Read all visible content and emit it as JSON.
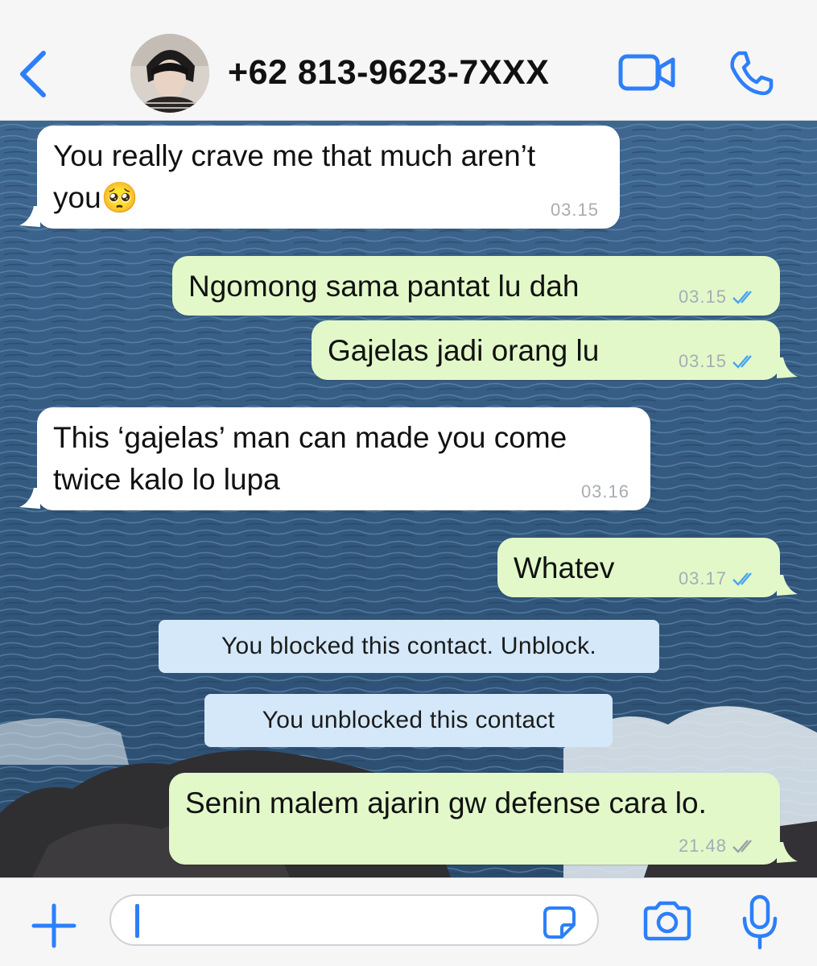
{
  "header": {
    "contact_name": "+62 813-9623-7XXX",
    "icons": {
      "back": "chevron-left-icon",
      "video": "video-camera-icon",
      "call": "phone-icon"
    },
    "accent_color": "#2d7ff9"
  },
  "messages": [
    {
      "direction": "incoming",
      "lines": [
        "You really crave me that much aren’t",
        "you🥺"
      ],
      "time": "03.15"
    },
    {
      "direction": "outgoing",
      "lines": [
        "Ngomong sama pantat lu dah"
      ],
      "time": "03.15",
      "status": "read"
    },
    {
      "direction": "outgoing",
      "lines": [
        "Gajelas jadi orang lu"
      ],
      "time": "03.15",
      "status": "read"
    },
    {
      "direction": "incoming",
      "lines": [
        "This ‘gajelas’ man can made you come",
        "twice kalo lo lupa"
      ],
      "time": "03.16"
    },
    {
      "direction": "outgoing",
      "lines": [
        "Whatev"
      ],
      "time": "03.17",
      "status": "read"
    },
    {
      "direction": "outgoing",
      "lines": [
        "Senin malem ajarin gw defense cara lo."
      ],
      "time": "21.48",
      "status": "delivered"
    }
  ],
  "system_messages": [
    {
      "text": "You blocked this contact. Unblock."
    },
    {
      "text": "You unblocked this contact"
    }
  ],
  "input_bar": {
    "value": "",
    "icons": {
      "plus": "plus-icon",
      "sticker": "sticker-icon",
      "camera": "camera-icon",
      "mic": "microphone-icon"
    }
  },
  "colors": {
    "incoming_bubble": "#ffffff",
    "outgoing_bubble": "#e2f8c9",
    "system_bubble": "#d4e8f9",
    "read_tick": "#4aa3f0",
    "delivered_tick": "#9aa0a6"
  }
}
